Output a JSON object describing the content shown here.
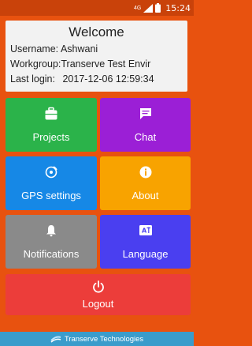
{
  "statusbar": {
    "time": "15:24",
    "network": "4G"
  },
  "welcome": {
    "title": "Welcome",
    "username_label": "Username:",
    "username": "Ashwani",
    "workgroup_label": "Workgroup:",
    "workgroup": "Transerve Test Envir",
    "lastlogin_label": "Last login:",
    "lastlogin": "2017-12-06 12:59:34"
  },
  "tiles": [
    {
      "label": "Projects",
      "icon": "briefcase-icon",
      "color": "#2bb34a"
    },
    {
      "label": "Chat",
      "icon": "chat-icon",
      "color": "#9b1fd6"
    },
    {
      "label": "GPS settings",
      "icon": "satellite-icon",
      "color": "#1688e6"
    },
    {
      "label": "About",
      "icon": "info-icon",
      "color": "#f8a300"
    },
    {
      "label": "Notifications",
      "icon": "bell-icon",
      "color": "#8a8a8a"
    },
    {
      "label": "Language",
      "icon": "translate-icon",
      "color": "#4a3ff0"
    },
    {
      "label": "Logout",
      "icon": "power-icon",
      "color": "#ec3d3a"
    }
  ],
  "footer": {
    "text": "Transerve Technologies"
  }
}
